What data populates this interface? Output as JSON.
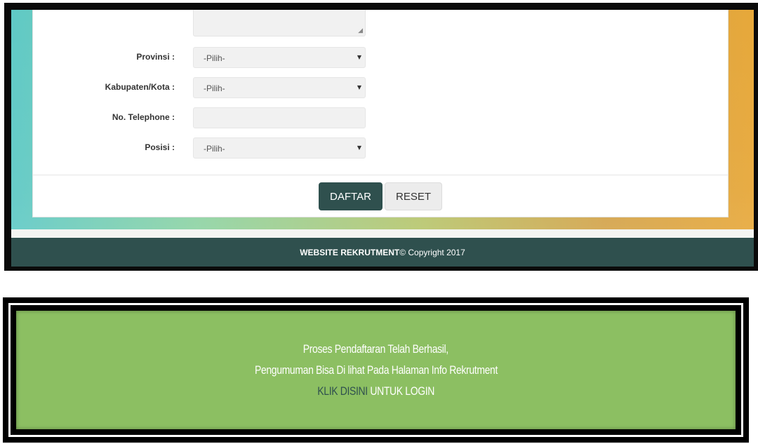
{
  "form": {
    "fields": [
      {
        "label": "Provinsi :",
        "value": "-Pilih-",
        "type": "select"
      },
      {
        "label": "Kabupaten/Kota :",
        "value": "-Pilih-",
        "type": "select"
      },
      {
        "label": "No. Telephone :",
        "value": "",
        "type": "input"
      },
      {
        "label": "Posisi :",
        "value": "-Pilih-",
        "type": "select"
      }
    ],
    "submit_label": "DAFTAR",
    "reset_label": "RESET"
  },
  "footer": {
    "brand": "WEBSITE REKRUTMENT",
    "copyright": " © Copyright 2017"
  },
  "notice": {
    "line1": "Proses Pendaftaran Telah Berhasil,",
    "line2": "Pengumuman Bisa Di lihat Pada Halaman Info Rekrutment",
    "link_text": "KLIK DISINI",
    "line3_rest": " UNTUK LOGIN"
  },
  "colors": {
    "primary": "#2f504e",
    "notice_bg": "#8cbf62"
  },
  "icons": {
    "select_caret": "▼",
    "resize_handle": "⁄⁄"
  }
}
